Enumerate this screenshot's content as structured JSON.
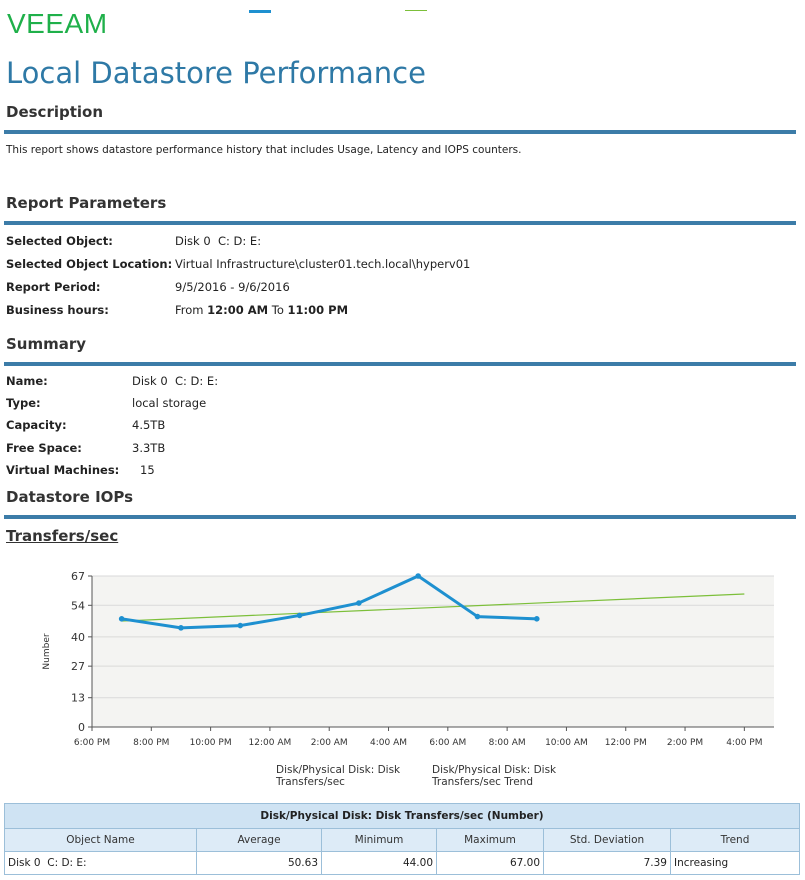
{
  "logo": "VEEAM",
  "title": "Local Datastore Performance",
  "description": {
    "heading": "Description",
    "text": "This report shows datastore performance history that includes Usage, Latency and IOPS counters."
  },
  "parameters": {
    "heading": "Report Parameters",
    "selected_object_label": "Selected Object:",
    "selected_object_value": "Disk 0  C: D: E:",
    "location_label": "Selected Object Location:",
    "location_value": "Virtual Infrastructure\\cluster01.tech.local\\hyperv01",
    "period_label": "Report Period:",
    "period_value": "9/5/2016 - 9/6/2016",
    "hours_label": "Business hours:",
    "hours_from": "From",
    "hours_start": "12:00 AM",
    "hours_to": "To",
    "hours_end": "11:00 PM"
  },
  "summary": {
    "heading": "Summary",
    "name_label": "Name:",
    "name_value": "Disk 0  C: D: E:",
    "type_label": "Type:",
    "type_value": "local storage",
    "capacity_label": "Capacity:",
    "capacity_value": "4.5TB",
    "free_label": "Free Space:",
    "free_value": "3.3TB",
    "vms_label": "Virtual Machines:",
    "vms_value": "15"
  },
  "iops": {
    "heading": "Datastore IOPs",
    "subheading": "Transfers/sec"
  },
  "chart_data": {
    "type": "line",
    "title": "",
    "xlabel": "",
    "ylabel": "Number",
    "x_ticks": [
      "6:00 PM",
      "8:00 PM",
      "10:00 PM",
      "12:00 AM",
      "2:00 AM",
      "4:00 AM",
      "6:00 AM",
      "8:00 AM",
      "10:00 AM",
      "12:00 PM",
      "2:00 PM",
      "4:00 PM"
    ],
    "y_ticks": [
      0,
      13,
      27,
      40,
      54,
      67
    ],
    "ylim": [
      0,
      67
    ],
    "xlim": [
      "9/5/2016 6:00 PM",
      "9/6/2016 5:00 PM"
    ],
    "grid": true,
    "legend_position": "bottom",
    "series": [
      {
        "name": "Disk/Physical Disk: Disk Transfers/sec",
        "color": "#1e90d0",
        "points": [
          {
            "x": "9/5/2016 7:00 PM",
            "y": 48
          },
          {
            "x": "9/5/2016 9:00 PM",
            "y": 44
          },
          {
            "x": "9/5/2016 11:00 PM",
            "y": 45
          },
          {
            "x": "9/6/2016 1:00 AM",
            "y": 49.5
          },
          {
            "x": "9/6/2016 3:00 AM",
            "y": 55
          },
          {
            "x": "9/6/2016 5:00 AM",
            "y": 67
          },
          {
            "x": "9/6/2016 7:00 AM",
            "y": 49
          },
          {
            "x": "9/6/2016 9:00 AM",
            "y": 48
          }
        ]
      },
      {
        "name": "Disk/Physical Disk: Disk Transfers/sec Trend",
        "color": "#7cbf3a",
        "points": [
          {
            "x": "9/5/2016 7:00 PM",
            "y": 47
          },
          {
            "x": "9/6/2016 4:00 PM",
            "y": 59
          }
        ]
      }
    ]
  },
  "table": {
    "caption": "Disk/Physical Disk: Disk Transfers/sec (Number)",
    "columns": [
      "Object Name",
      "Average",
      "Minimum",
      "Maximum",
      "Std. Deviation",
      "Trend"
    ],
    "rows": [
      [
        "Disk 0  C: D: E:",
        "50.63",
        "44.00",
        "67.00",
        "7.39",
        "Increasing"
      ]
    ]
  }
}
